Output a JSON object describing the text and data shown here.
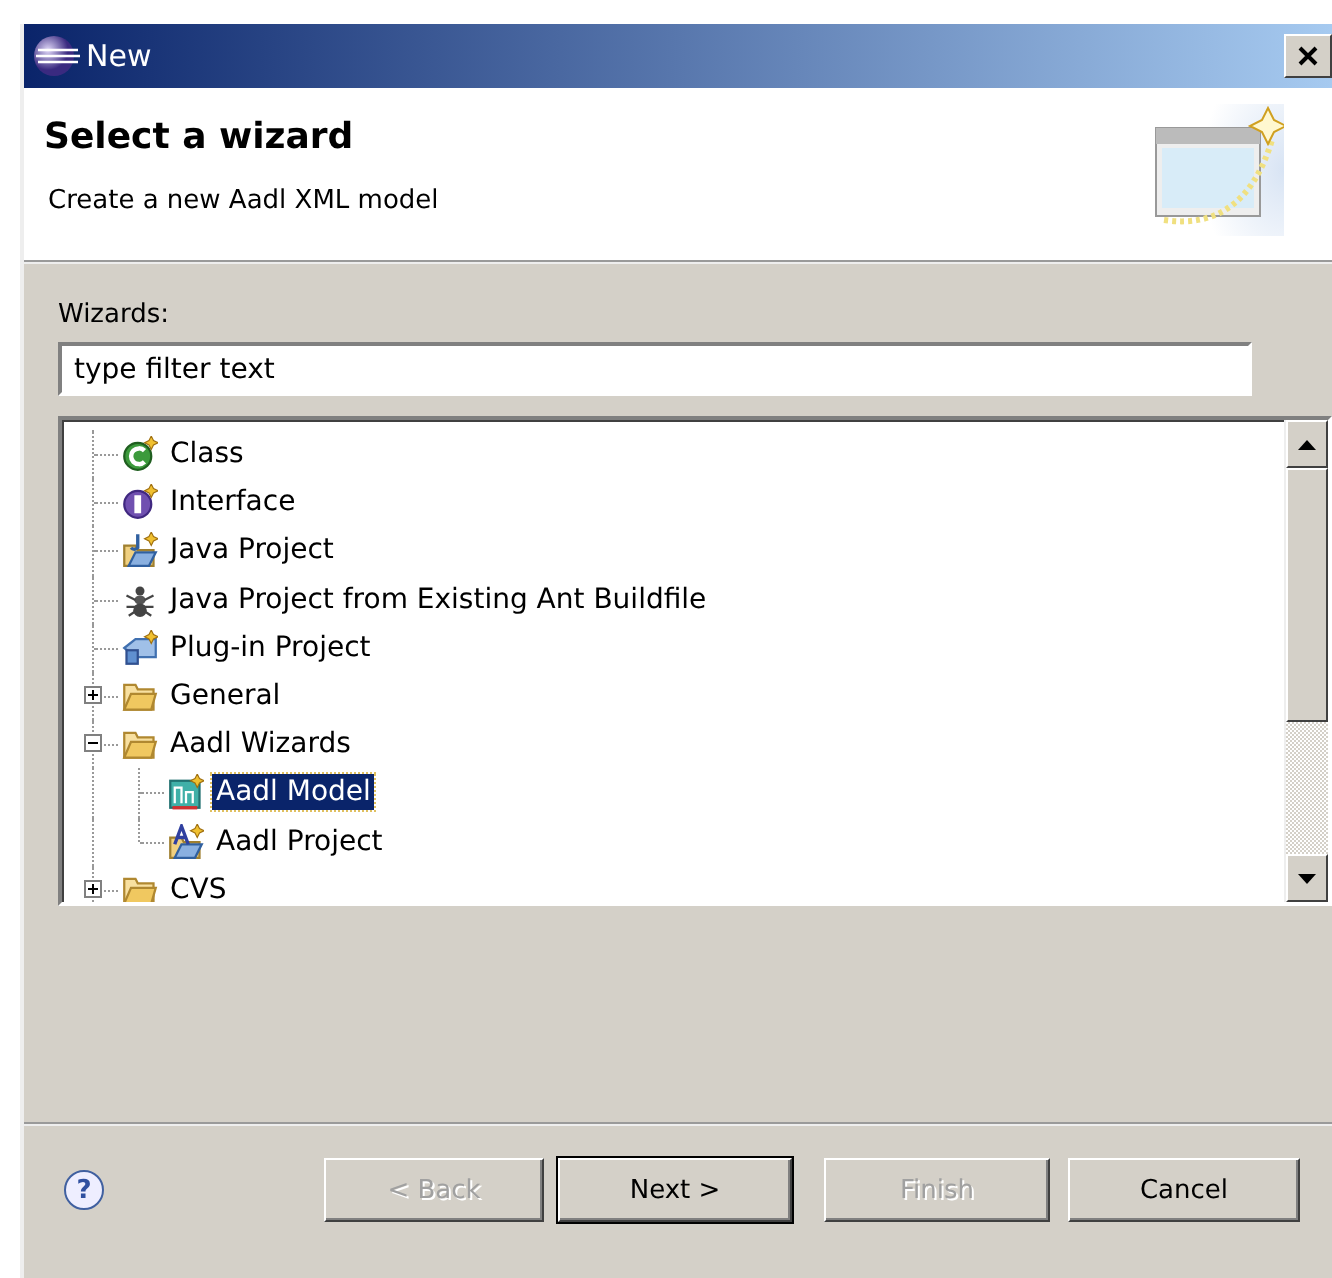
{
  "window": {
    "title": "New"
  },
  "header": {
    "title": "Select a wizard",
    "description": "Create a new Aadl XML model"
  },
  "filter": {
    "label": "Wizards:",
    "placeholder": "type filter text"
  },
  "tree": [
    {
      "label": "Class",
      "kind": "class",
      "selected": false
    },
    {
      "label": "Interface",
      "kind": "interface",
      "selected": false
    },
    {
      "label": "Java Project",
      "kind": "java-project",
      "selected": false
    },
    {
      "label": "Java Project from Existing Ant Buildfile",
      "kind": "ant",
      "selected": false
    },
    {
      "label": "Plug-in Project",
      "kind": "plugin",
      "selected": false
    },
    {
      "label": "General",
      "kind": "folder",
      "selected": false,
      "expanded": false
    },
    {
      "label": "Aadl Wizards",
      "kind": "folder",
      "selected": false,
      "expanded": true,
      "children": [
        {
          "label": "Aadl Model",
          "kind": "aadl-model",
          "selected": true
        },
        {
          "label": "Aadl Project",
          "kind": "aadl-project",
          "selected": false
        }
      ]
    },
    {
      "label": "CVS",
      "kind": "folder",
      "selected": false,
      "expanded": false
    }
  ],
  "help": "?",
  "buttons": [
    {
      "label": "< Back",
      "disabled": true,
      "default": false
    },
    {
      "label": "Next >",
      "disabled": false,
      "default": true
    },
    {
      "label": "Finish",
      "disabled": true,
      "default": false
    },
    {
      "label": "Cancel",
      "disabled": false,
      "default": false
    }
  ]
}
